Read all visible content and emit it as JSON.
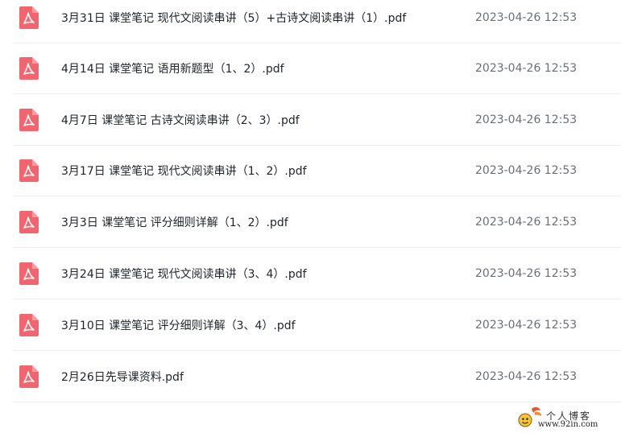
{
  "files": [
    {
      "name": "3月31日 课堂笔记 现代文阅读串讲（5）+古诗文阅读串讲（1）.pdf",
      "date": "2023-04-26 12:53",
      "icon": "pdf-icon"
    },
    {
      "name": "4月14日 课堂笔记 语用新题型（1、2）.pdf",
      "date": "2023-04-26 12:53",
      "icon": "pdf-icon"
    },
    {
      "name": "4月7日 课堂笔记 古诗文阅读串讲（2、3）.pdf",
      "date": "2023-04-26 12:53",
      "icon": "pdf-icon"
    },
    {
      "name": "3月17日 课堂笔记 现代文阅读串讲（1、2）.pdf",
      "date": "2023-04-26 12:53",
      "icon": "pdf-icon"
    },
    {
      "name": "3月3日 课堂笔记 评分细则详解（1、2）.pdf",
      "date": "2023-04-26 12:53",
      "icon": "pdf-icon"
    },
    {
      "name": "3月24日 课堂笔记 现代文阅读串讲（3、4）.pdf",
      "date": "2023-04-26 12:53",
      "icon": "pdf-icon"
    },
    {
      "name": "3月10日 课堂笔记 评分细则详解（3、4）.pdf",
      "date": "2023-04-26 12:53",
      "icon": "pdf-icon"
    },
    {
      "name": "2月26日先导课资料.pdf",
      "date": "2023-04-26 12:53",
      "icon": "pdf-icon"
    }
  ],
  "watermark": {
    "title": "个人博客",
    "url": "www.92in.com"
  },
  "colors": {
    "pdf_icon": "#f2646e",
    "text": "#1f2329",
    "date": "#6a6f77",
    "divider": "#eef0f2"
  }
}
